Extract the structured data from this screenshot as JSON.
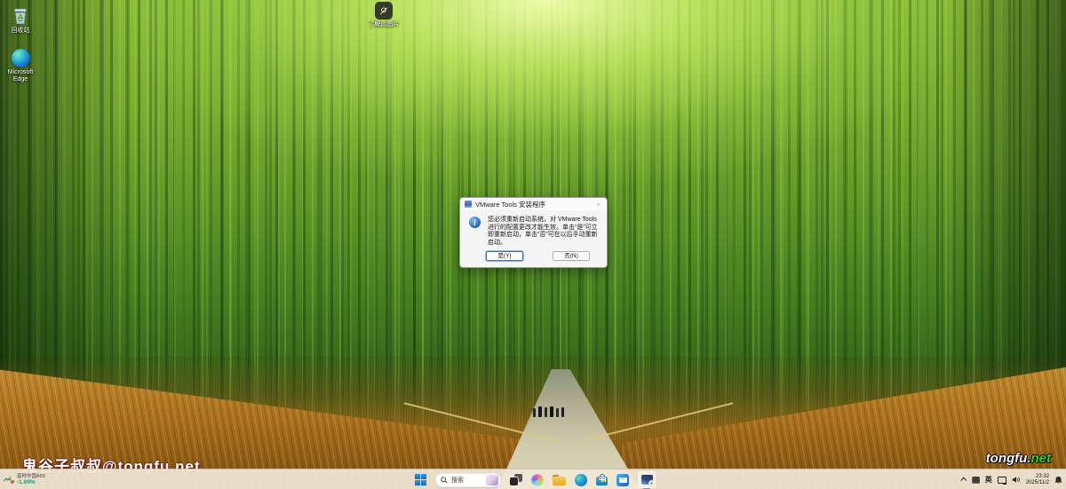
{
  "desktop": {
    "icons": [
      {
        "name": "recycle-bin",
        "label": "回收站"
      },
      {
        "name": "microsoft-edge",
        "label": "Microsoft Edge"
      },
      {
        "name": "learn-about-picture",
        "label": "了解此图片"
      }
    ],
    "watermark_left": "鬼谷子叔叔@tongfu.net",
    "watermark_right": {
      "white": "tongfu",
      "dot": ".",
      "green": "net"
    }
  },
  "dialog": {
    "title": "VMware Tools 安装程序",
    "close_glyph": "×",
    "info_glyph": "i",
    "message": "您必须重新启动系统，对 VMware Tools 进行的配置更改才能生效。单击“是”可立即重新启动，单击“否”可在以后手动重新启动。",
    "buttons": {
      "yes": "是(Y)",
      "no": "否(N)"
    }
  },
  "taskbar": {
    "stock_widget": {
      "name": "富时中国A50",
      "change": "-1.69%"
    },
    "search": {
      "placeholder": "搜索"
    },
    "icons": [
      "start",
      "search",
      "task-view",
      "copilot",
      "file-explorer",
      "edge",
      "microsoft-store",
      "outlook",
      "vmware-tools-installer"
    ],
    "tray": {
      "ime": "英",
      "time": "23:32",
      "date": "2025/11/2"
    }
  },
  "colors": {
    "accent_blue": "#2f6fd0",
    "taskbar_tint": "#f0e7d6",
    "logo_green": "#3ecf1e",
    "stock_down_green": "#149e7c"
  }
}
